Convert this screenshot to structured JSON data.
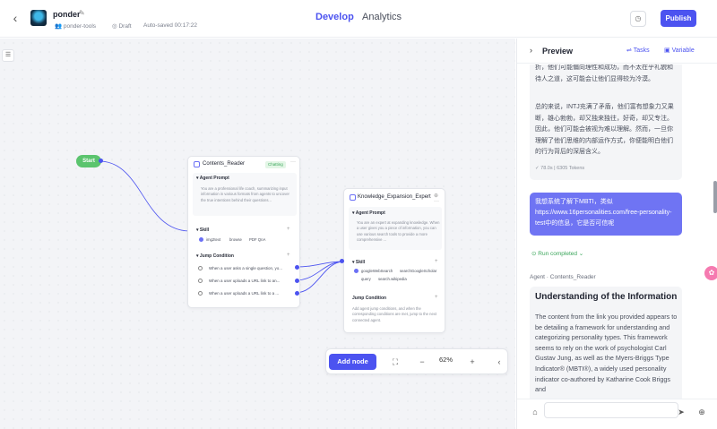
{
  "header": {
    "back_icon": "chevron-left-icon",
    "app_name": "ponder",
    "workspace": "ponder-tools",
    "status": "Draft",
    "autosave": "Auto-saved 00:17:22",
    "tabs": [
      {
        "label": "Develop"
      },
      {
        "label": "Analytics"
      }
    ],
    "publish_label": "Publish"
  },
  "canvas": {
    "start_label": "Start",
    "node1": {
      "title": "Contents_Reader",
      "chip": "Chatting",
      "prompt_title": "Agent Prompt",
      "prompt_text": "You are a professional life coach, summarizing input information in various formats from agents to uncover the true intentions behind their questions...",
      "skill_title": "Skill",
      "skills": [
        "img2text",
        "browse",
        "PDF QnA"
      ],
      "jump_title": "Jump Condition",
      "conditions": [
        "When a user asks a single question, yo...",
        "When a user uploads a URL link to an...",
        "When a user uploads a URL link to a ..."
      ]
    },
    "node2": {
      "title": "Knowledge_Expansion_Expert",
      "prompt_title": "Agent Prompt",
      "prompt_text": "You are an expert at expanding knowledge. When a user gives you a piece of information, you can use various search tools to provide a more comprehensive ...",
      "skill_title": "Skill",
      "skills": [
        "googleWebSearch",
        "searchGoogleScholar",
        "query",
        "search.wikipedia"
      ],
      "jump_title": "Jump Condition",
      "jump_text": "Add agent jump conditions, and when the corresponding conditions are met, jump to the next connected agent."
    },
    "toolbar": {
      "add_node": "Add node",
      "zoom": "62%"
    }
  },
  "preview": {
    "title": "Preview",
    "tasks": "Tasks",
    "variable": "Variable",
    "bot_text_1": "折，他们可能偏向理性和成功，而不太在乎礼貌和待人之道，这可能会让他们显得较为冷漠。",
    "bot_text_2": "总的来说，INTJ充满了矛盾，他们富有想象力又果断，雄心勃勃，却又独来独往，好奇，却又专注。因此，他们可能会被视为难以理解。然而，一旦你理解了他们思维的内部运作方式，你便能明白他们的行为背后的深层含义。",
    "stats": "78.0s  |  6305 Tokens",
    "user_text": "我想系统了解下MBTI，类似https://www.16personalities.com/free-personality-test中的信息，它是否可信呢",
    "run_status": "Run completed",
    "agent_label": "Agent · Contents_Reader",
    "answer_title": "Understanding of the Information",
    "answer_text": "The content from the link you provided appears to be detailing a framework for understanding and categorizing personality types. This framework seems to rely on the work of psychologist Carl Gustav Jung, as well as the Myers-Briggs Type Indicator® (MBTI®), a widely used personality indicator co-authored by Katharine Cook Briggs and",
    "input_placeholder": ""
  },
  "colors": {
    "accent": "#4c53f0",
    "start": "#5bc46e",
    "success": "#3aa55a",
    "user_bubble": "#6f74f3"
  }
}
